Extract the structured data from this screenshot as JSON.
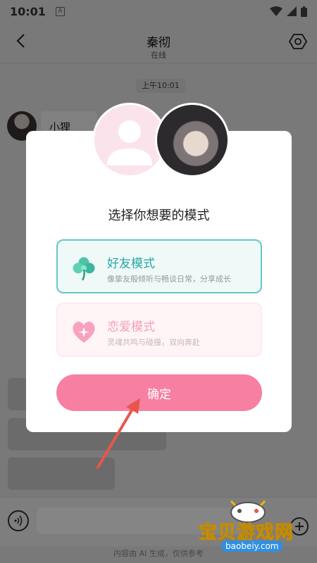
{
  "status_bar": {
    "time": "10:01",
    "app_icon": "A"
  },
  "header": {
    "title": "秦彻",
    "subtitle": "在线"
  },
  "chat": {
    "timestamp": "上午10:01",
    "first_message": "小狸花，"
  },
  "modal": {
    "title": "选择你想要的模式",
    "modes": [
      {
        "name": "好友模式",
        "desc": "像挚友般倾听与畅谈日常，分享成长",
        "icon": "clover-icon",
        "selected": true
      },
      {
        "name": "恋爱模式",
        "desc": "灵魂共鸣与碰撞，双向奔赴",
        "icon": "heart-icon",
        "selected": false
      }
    ],
    "confirm_label": "确定"
  },
  "input_bar": {
    "placeholder": ""
  },
  "disclaimer": "内容由 AI 生成，仅供参考",
  "watermark": {
    "text": "宝贝游戏网",
    "url": "baobeiy.com"
  },
  "colors": {
    "accent_pink": "#f77fa2",
    "friend_teal": "#65c7c4",
    "arrow_red": "#e9554b"
  }
}
